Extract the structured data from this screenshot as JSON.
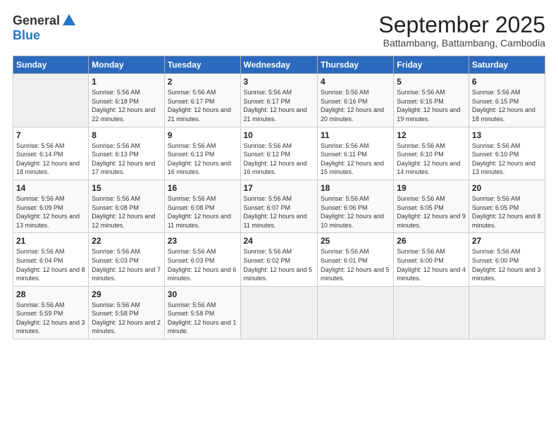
{
  "header": {
    "logo_general": "General",
    "logo_blue": "Blue",
    "month_title": "September 2025",
    "location": "Battambang, Battambang, Cambodia"
  },
  "weekdays": [
    "Sunday",
    "Monday",
    "Tuesday",
    "Wednesday",
    "Thursday",
    "Friday",
    "Saturday"
  ],
  "weeks": [
    [
      {
        "day": "",
        "info": ""
      },
      {
        "day": "1",
        "info": "Sunrise: 5:56 AM\nSunset: 6:18 PM\nDaylight: 12 hours\nand 22 minutes."
      },
      {
        "day": "2",
        "info": "Sunrise: 5:56 AM\nSunset: 6:17 PM\nDaylight: 12 hours\nand 21 minutes."
      },
      {
        "day": "3",
        "info": "Sunrise: 5:56 AM\nSunset: 6:17 PM\nDaylight: 12 hours\nand 21 minutes."
      },
      {
        "day": "4",
        "info": "Sunrise: 5:56 AM\nSunset: 6:16 PM\nDaylight: 12 hours\nand 20 minutes."
      },
      {
        "day": "5",
        "info": "Sunrise: 5:56 AM\nSunset: 6:15 PM\nDaylight: 12 hours\nand 19 minutes."
      },
      {
        "day": "6",
        "info": "Sunrise: 5:56 AM\nSunset: 6:15 PM\nDaylight: 12 hours\nand 18 minutes."
      }
    ],
    [
      {
        "day": "7",
        "info": "Sunrise: 5:56 AM\nSunset: 6:14 PM\nDaylight: 12 hours\nand 18 minutes."
      },
      {
        "day": "8",
        "info": "Sunrise: 5:56 AM\nSunset: 6:13 PM\nDaylight: 12 hours\nand 17 minutes."
      },
      {
        "day": "9",
        "info": "Sunrise: 5:56 AM\nSunset: 6:13 PM\nDaylight: 12 hours\nand 16 minutes."
      },
      {
        "day": "10",
        "info": "Sunrise: 5:56 AM\nSunset: 6:12 PM\nDaylight: 12 hours\nand 16 minutes."
      },
      {
        "day": "11",
        "info": "Sunrise: 5:56 AM\nSunset: 6:11 PM\nDaylight: 12 hours\nand 15 minutes."
      },
      {
        "day": "12",
        "info": "Sunrise: 5:56 AM\nSunset: 6:10 PM\nDaylight: 12 hours\nand 14 minutes."
      },
      {
        "day": "13",
        "info": "Sunrise: 5:56 AM\nSunset: 6:10 PM\nDaylight: 12 hours\nand 13 minutes."
      }
    ],
    [
      {
        "day": "14",
        "info": "Sunrise: 5:56 AM\nSunset: 6:09 PM\nDaylight: 12 hours\nand 13 minutes."
      },
      {
        "day": "15",
        "info": "Sunrise: 5:56 AM\nSunset: 6:08 PM\nDaylight: 12 hours\nand 12 minutes."
      },
      {
        "day": "16",
        "info": "Sunrise: 5:56 AM\nSunset: 6:08 PM\nDaylight: 12 hours\nand 11 minutes."
      },
      {
        "day": "17",
        "info": "Sunrise: 5:56 AM\nSunset: 6:07 PM\nDaylight: 12 hours\nand 11 minutes."
      },
      {
        "day": "18",
        "info": "Sunrise: 5:56 AM\nSunset: 6:06 PM\nDaylight: 12 hours\nand 10 minutes."
      },
      {
        "day": "19",
        "info": "Sunrise: 5:56 AM\nSunset: 6:05 PM\nDaylight: 12 hours\nand 9 minutes."
      },
      {
        "day": "20",
        "info": "Sunrise: 5:56 AM\nSunset: 6:05 PM\nDaylight: 12 hours\nand 8 minutes."
      }
    ],
    [
      {
        "day": "21",
        "info": "Sunrise: 5:56 AM\nSunset: 6:04 PM\nDaylight: 12 hours\nand 8 minutes."
      },
      {
        "day": "22",
        "info": "Sunrise: 5:56 AM\nSunset: 6:03 PM\nDaylight: 12 hours\nand 7 minutes."
      },
      {
        "day": "23",
        "info": "Sunrise: 5:56 AM\nSunset: 6:03 PM\nDaylight: 12 hours\nand 6 minutes."
      },
      {
        "day": "24",
        "info": "Sunrise: 5:56 AM\nSunset: 6:02 PM\nDaylight: 12 hours\nand 5 minutes."
      },
      {
        "day": "25",
        "info": "Sunrise: 5:56 AM\nSunset: 6:01 PM\nDaylight: 12 hours\nand 5 minutes."
      },
      {
        "day": "26",
        "info": "Sunrise: 5:56 AM\nSunset: 6:00 PM\nDaylight: 12 hours\nand 4 minutes."
      },
      {
        "day": "27",
        "info": "Sunrise: 5:56 AM\nSunset: 6:00 PM\nDaylight: 12 hours\nand 3 minutes."
      }
    ],
    [
      {
        "day": "28",
        "info": "Sunrise: 5:56 AM\nSunset: 5:59 PM\nDaylight: 12 hours\nand 3 minutes."
      },
      {
        "day": "29",
        "info": "Sunrise: 5:56 AM\nSunset: 5:58 PM\nDaylight: 12 hours\nand 2 minutes."
      },
      {
        "day": "30",
        "info": "Sunrise: 5:56 AM\nSunset: 5:58 PM\nDaylight: 12 hours\nand 1 minute."
      },
      {
        "day": "",
        "info": ""
      },
      {
        "day": "",
        "info": ""
      },
      {
        "day": "",
        "info": ""
      },
      {
        "day": "",
        "info": ""
      }
    ]
  ]
}
